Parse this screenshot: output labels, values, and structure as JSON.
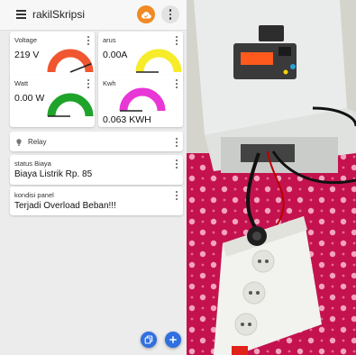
{
  "app": {
    "title": "rakilSkripsi",
    "icons": {
      "menu": "hamburger-icon",
      "cloud": "cloud-icon",
      "more": "more-vertical-icon"
    },
    "accent_color": "#f08a24"
  },
  "gauges": [
    {
      "label": "Voltage",
      "value_text": "219 V",
      "fill_fraction": 0.88,
      "color": "#f0562f"
    },
    {
      "label": "arus",
      "value_text": "0.00A",
      "fill_fraction": 0.0,
      "color": "#f6ec2a"
    },
    {
      "label": "Watt",
      "value_text": "0.00 W",
      "fill_fraction": 0.0,
      "color": "#1fa32a"
    },
    {
      "label": "Kwh",
      "value_text": "0.063 KWH",
      "fill_fraction": 0.0,
      "color": "#e936d6"
    }
  ],
  "relay": {
    "label": "Relay",
    "icon": "bulb-icon"
  },
  "status_cards": [
    {
      "label": "status Biaya",
      "value": "Biaya Listrik Rp. 85"
    },
    {
      "label": "kondisi panel",
      "value": "Terjadi Overload Beban!!!"
    }
  ],
  "fabs": {
    "copy": "copy-icon",
    "add": "plus-icon",
    "color": "#2f6fe0"
  },
  "photo": {
    "subject": "photo-of-power-panel-and-power-strip"
  }
}
